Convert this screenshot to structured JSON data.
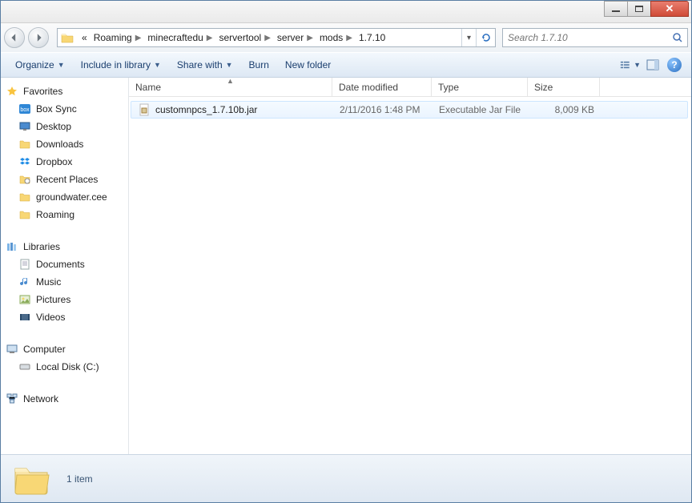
{
  "breadcrumbs": {
    "prefix": "«",
    "items": [
      "Roaming",
      "minecraftedu",
      "servertool",
      "server",
      "mods",
      "1.7.10"
    ]
  },
  "search": {
    "placeholder": "Search 1.7.10"
  },
  "toolbar": {
    "organize": "Organize",
    "include": "Include in library",
    "share": "Share with",
    "burn": "Burn",
    "newfolder": "New folder"
  },
  "columns": {
    "name": "Name",
    "date": "Date modified",
    "type": "Type",
    "size": "Size"
  },
  "files": [
    {
      "name": "customnpcs_1.7.10b.jar",
      "date": "2/11/2016 1:48 PM",
      "type": "Executable Jar File",
      "size": "8,009 KB"
    }
  ],
  "sidebar": {
    "favorites": {
      "label": "Favorites",
      "items": [
        "Box Sync",
        "Desktop",
        "Downloads",
        "Dropbox",
        "Recent Places",
        "groundwater.cee",
        "Roaming"
      ]
    },
    "libraries": {
      "label": "Libraries",
      "items": [
        "Documents",
        "Music",
        "Pictures",
        "Videos"
      ]
    },
    "computer": {
      "label": "Computer",
      "items": [
        "Local Disk (C:)"
      ]
    },
    "network": {
      "label": "Network"
    }
  },
  "status": {
    "count": "1 item"
  }
}
